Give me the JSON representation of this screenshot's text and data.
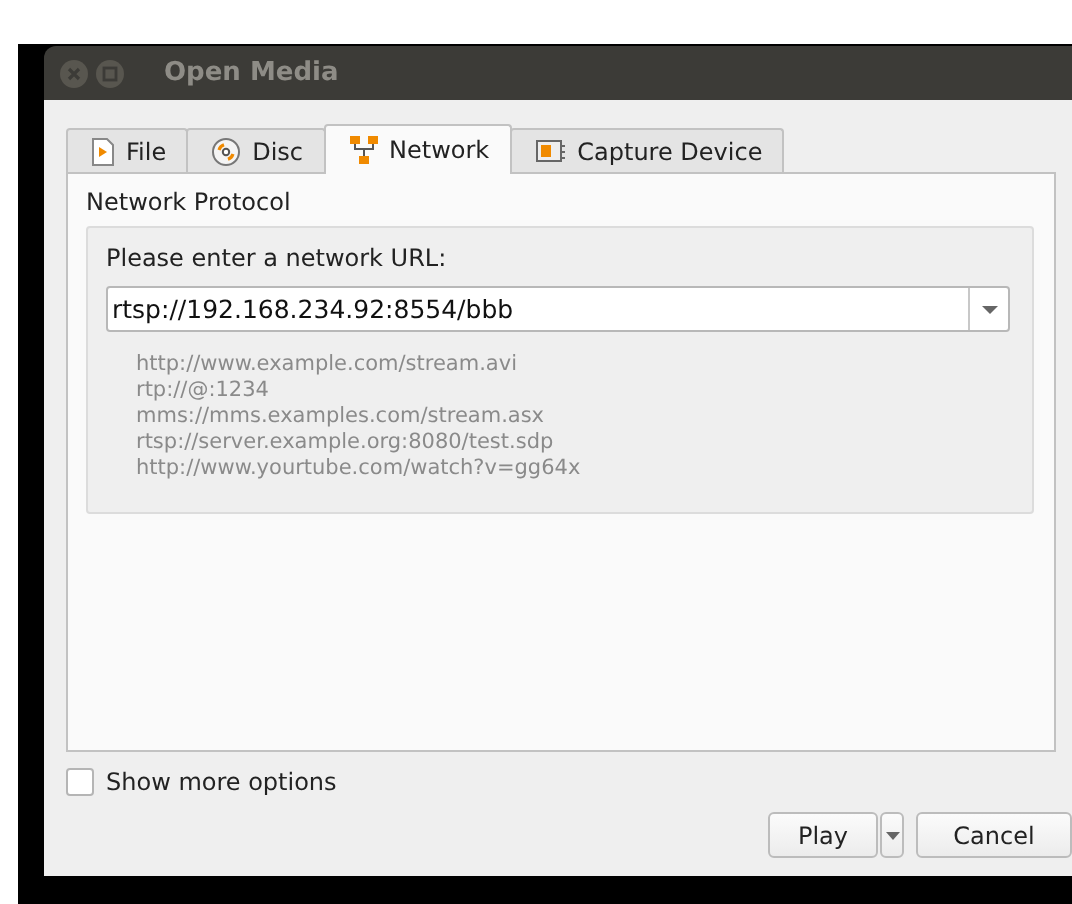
{
  "window": {
    "title": "Open Media"
  },
  "tabs": [
    {
      "label": "File",
      "kind": "file",
      "selected": false
    },
    {
      "label": "Disc",
      "kind": "disc",
      "selected": false
    },
    {
      "label": "Network",
      "kind": "network",
      "selected": true
    },
    {
      "label": "Capture Device",
      "kind": "capture",
      "selected": false
    }
  ],
  "group": {
    "title": "Network Protocol",
    "prompt": "Please enter a network URL:",
    "url": "rtsp://192.168.234.92:8554/bbb",
    "examples": [
      "http://www.example.com/stream.avi",
      "rtp://@:1234",
      "mms://mms.examples.com/stream.asx",
      "rtsp://server.example.org:8080/test.sdp",
      "http://www.yourtube.com/watch?v=gg64x"
    ]
  },
  "show_more": {
    "label": "Show more options",
    "checked": false
  },
  "buttons": [
    {
      "label": "Play",
      "kind": "split"
    },
    {
      "label": "Cancel",
      "kind": "plain"
    }
  ]
}
